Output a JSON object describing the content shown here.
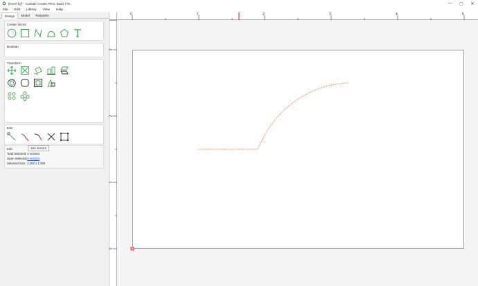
{
  "window": {
    "title": "[Noref.fq]* - Carbide Create PRO, Build 778",
    "controls": [
      "—",
      "▢",
      "✕"
    ]
  },
  "menu": [
    "File",
    "Edit",
    "Library",
    "View",
    "Help"
  ],
  "tabs": [
    "Design",
    "Model",
    "Toolpaths"
  ],
  "groups": {
    "create_vector": "Create Vector",
    "boolean": "Boolean",
    "transform": "Transform",
    "edit": "Edit",
    "info": "Info"
  },
  "tooltip": "Join Vectors",
  "info": {
    "total_selected_label": "Total Selected:",
    "total_selected_value": "2 Vectors",
    "open_selected_label": "Open Selected:",
    "open_selected_value": "2 Vectors",
    "selected_size_label": "Selected Size:",
    "selected_size_value": "2.250 x 1.000"
  },
  "rulers": {
    "top": [
      "0",
      "1",
      "2",
      "3",
      "4",
      "5"
    ],
    "left": [
      "3",
      "2",
      "1",
      "0"
    ]
  },
  "colors": {
    "accent": "#e53935",
    "vector": "#e8782a",
    "tool_green": "#3aa64a"
  }
}
